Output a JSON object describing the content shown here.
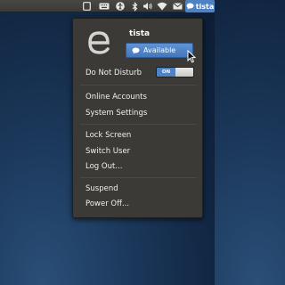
{
  "panel": {
    "user_label": "tista",
    "indicators": [
      "window-icon",
      "keyboard-icon",
      "accessibility-icon",
      "bluetooth-icon",
      "volume-icon",
      "wifi-icon",
      "mail-icon",
      "chat-status-icon"
    ]
  },
  "menu": {
    "username": "tista",
    "status_label": "Available",
    "do_not_disturb": {
      "label": "Do Not Disturb",
      "toggle_label": "ON",
      "enabled": true
    },
    "accounts_items": [
      "Online Accounts",
      "System Settings"
    ],
    "session_items": [
      "Lock Screen",
      "Switch User",
      "Log Out..."
    ],
    "power_items": [
      "Suspend",
      "Power Off..."
    ]
  },
  "colors": {
    "accent": "#4f82c4",
    "menu_bg": "#3b3a37",
    "panel_bg": "#3d3c38"
  }
}
